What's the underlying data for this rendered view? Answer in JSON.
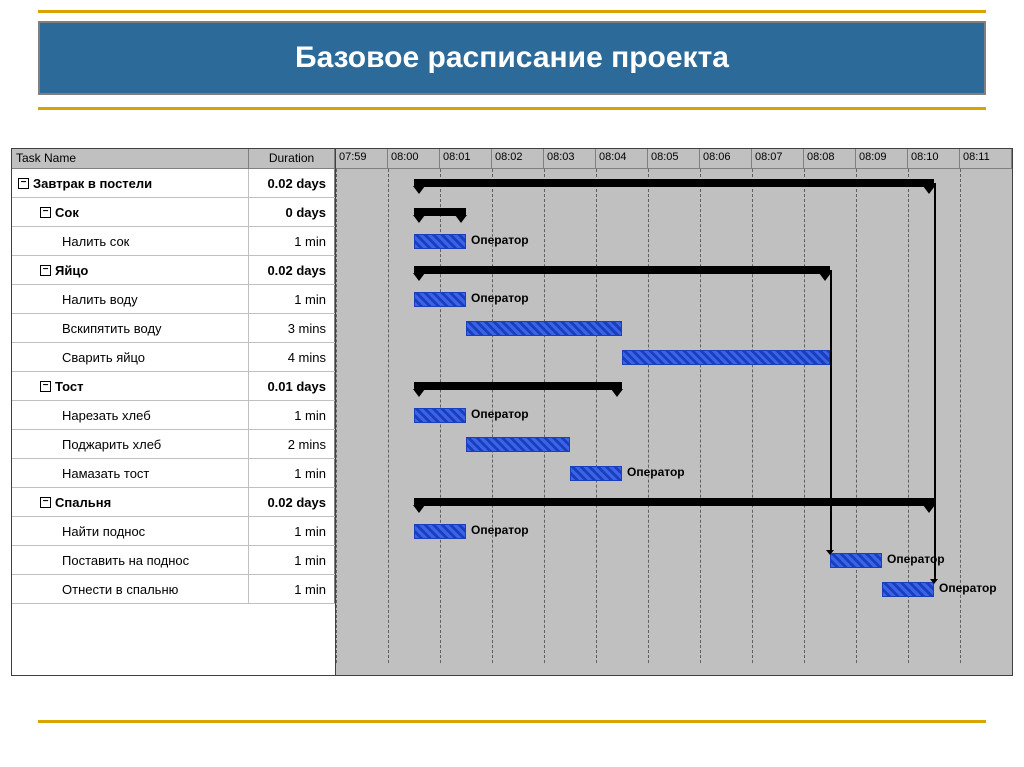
{
  "title": "Базовое расписание проекта",
  "columns": {
    "name": "Task Name",
    "duration": "Duration"
  },
  "timeline": [
    "07:59",
    "08:00",
    "08:01",
    "08:02",
    "08:03",
    "08:04",
    "08:05",
    "08:06",
    "08:07",
    "08:08",
    "08:09",
    "08:10",
    "08:11"
  ],
  "operator_label": "Оператор",
  "tasks": [
    {
      "name": "Завтрак в постели",
      "duration": "0.02 days",
      "type": "summary",
      "indent": 0,
      "start": 0,
      "span": 10
    },
    {
      "name": "Сок",
      "duration": "0 days",
      "type": "summary",
      "indent": 1,
      "start": 0,
      "span": 1
    },
    {
      "name": "Налить сок",
      "duration": "1 min",
      "type": "task",
      "indent": 2,
      "start": 0,
      "span": 1,
      "label": true
    },
    {
      "name": "Яйцо",
      "duration": "0.02 days",
      "type": "summary",
      "indent": 1,
      "start": 0,
      "span": 8
    },
    {
      "name": "Налить воду",
      "duration": "1 min",
      "type": "task",
      "indent": 2,
      "start": 0,
      "span": 1,
      "label": true
    },
    {
      "name": "Вскипятить воду",
      "duration": "3 mins",
      "type": "task",
      "indent": 2,
      "start": 1,
      "span": 3
    },
    {
      "name": "Сварить яйцо",
      "duration": "4 mins",
      "type": "task",
      "indent": 2,
      "start": 4,
      "span": 4
    },
    {
      "name": "Тост",
      "duration": "0.01 days",
      "type": "summary",
      "indent": 1,
      "start": 0,
      "span": 4
    },
    {
      "name": "Нарезать хлеб",
      "duration": "1 min",
      "type": "task",
      "indent": 2,
      "start": 0,
      "span": 1,
      "label": true
    },
    {
      "name": "Поджарить хлеб",
      "duration": "2 mins",
      "type": "task",
      "indent": 2,
      "start": 1,
      "span": 2
    },
    {
      "name": "Намазать тост",
      "duration": "1 min",
      "type": "task",
      "indent": 2,
      "start": 3,
      "span": 1,
      "label": true
    },
    {
      "name": "Спальня",
      "duration": "0.02 days",
      "type": "summary",
      "indent": 1,
      "start": 0,
      "span": 10
    },
    {
      "name": "Найти поднос",
      "duration": "1 min",
      "type": "task",
      "indent": 2,
      "start": 0,
      "span": 1,
      "label": true
    },
    {
      "name": "Поставить на поднос",
      "duration": "1 min",
      "type": "task",
      "indent": 2,
      "start": 8,
      "span": 1,
      "label": true
    },
    {
      "name": "Отнести в спальню",
      "duration": "1 min",
      "type": "task",
      "indent": 2,
      "start": 9,
      "span": 1,
      "label": true
    }
  ]
}
